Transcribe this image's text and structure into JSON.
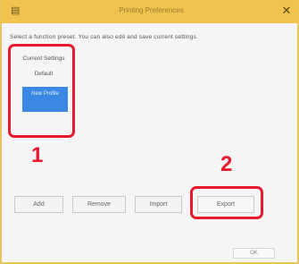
{
  "window": {
    "title": "Printing Preferences",
    "close_glyph": "✕",
    "app_glyph": "▤"
  },
  "description": "Select a function preset. You can also edit and save current settings.",
  "list": {
    "items": [
      "Current Settings",
      "Default",
      "New Profile"
    ]
  },
  "markers": {
    "one": "1",
    "two": "2"
  },
  "buttons": {
    "b1": "Add",
    "b2": "Remove",
    "b3": "Import",
    "b4": "Export"
  },
  "footer": {
    "button": "OK"
  },
  "colors": {
    "titlebar": "#f0c34e",
    "highlight": "#e8192a",
    "selection": "#3b88e4"
  }
}
